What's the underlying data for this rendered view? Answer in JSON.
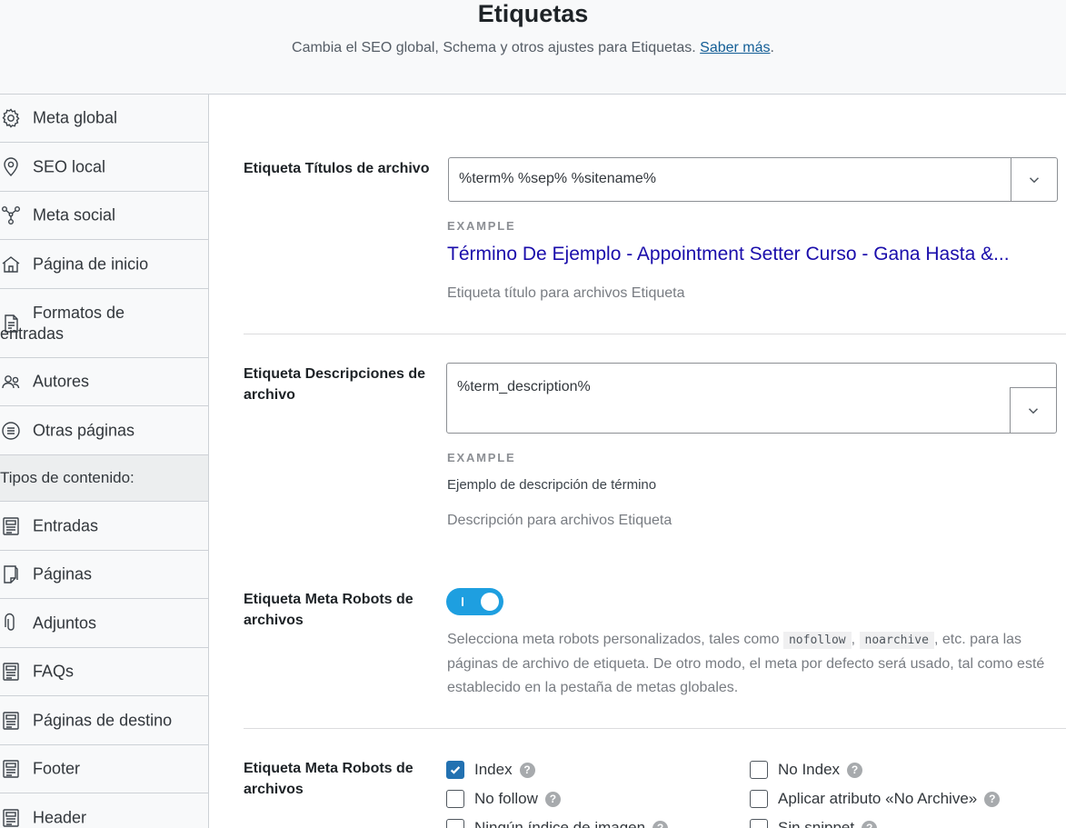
{
  "header": {
    "title": "Etiquetas",
    "subtitle": "Cambia el SEO global, Schema y otros ajustes para Etiquetas.",
    "link": "Saber más",
    "period": "."
  },
  "sidebar": {
    "items": [
      {
        "label": "Meta global",
        "icon": "gear-icon"
      },
      {
        "label": "SEO local",
        "icon": "map-pin-icon"
      },
      {
        "label": "Meta social",
        "icon": "share-network-icon"
      },
      {
        "label": "Página de inicio",
        "icon": "home-icon"
      },
      {
        "label": "Formatos de entradas",
        "icon": "document-icon"
      },
      {
        "label": "Autores",
        "icon": "users-icon"
      },
      {
        "label": "Otras páginas",
        "icon": "list-circle-icon"
      }
    ],
    "section_heading": "Tipos de contenido:",
    "content_types": [
      {
        "label": "Entradas",
        "icon": "post-icon"
      },
      {
        "label": "Páginas",
        "icon": "page-icon"
      },
      {
        "label": "Adjuntos",
        "icon": "paperclip-icon"
      },
      {
        "label": "FAQs",
        "icon": "post-icon"
      },
      {
        "label": "Páginas de destino",
        "icon": "post-icon"
      },
      {
        "label": "Footer",
        "icon": "post-icon"
      },
      {
        "label": "Header",
        "icon": "post-icon"
      }
    ]
  },
  "settings": {
    "title_row": {
      "label": "Etiqueta Títulos de archivo",
      "value": "%term% %sep% %sitename%",
      "example_label": "EXAMPLE",
      "example_text": "Término De Ejemplo - Appointment Setter Curso - Gana Hasta &...",
      "help": "Etiqueta título para archivos Etiqueta"
    },
    "desc_row": {
      "label": "Etiqueta Descripciones de archivo",
      "value": "%term_description%",
      "example_label": "EXAMPLE",
      "example_text": "Ejemplo de descripción de término",
      "help": "Descripción para archivos Etiqueta"
    },
    "robots_toggle_row": {
      "label": "Etiqueta Meta Robots de archivos",
      "enabled": true,
      "help_before": "Selecciona meta robots personalizados, tales como",
      "code1": "nofollow",
      "sep": ",",
      "code2": "noarchive",
      "help_after": ", etc. para las páginas de archivo de etiqueta. De otro modo, el meta por defecto será usado, tal como esté establecido en la pestaña de metas globales."
    },
    "robots_options_row": {
      "label": "Etiqueta Meta Robots de archivos",
      "help_glyph": "?",
      "options": [
        {
          "label": "Index",
          "checked": true
        },
        {
          "label": "No Index",
          "checked": false
        },
        {
          "label": "No follow",
          "checked": false
        },
        {
          "label": "Aplicar atributo «No Archive»",
          "checked": false
        },
        {
          "label": "Ningún índice de imagen",
          "checked": false
        },
        {
          "label": "Sin snippet",
          "checked": false
        }
      ]
    }
  },
  "colors": {
    "accent": "#2271b1",
    "toggle": "#1e9fe0",
    "example_link": "#1a0dab"
  }
}
